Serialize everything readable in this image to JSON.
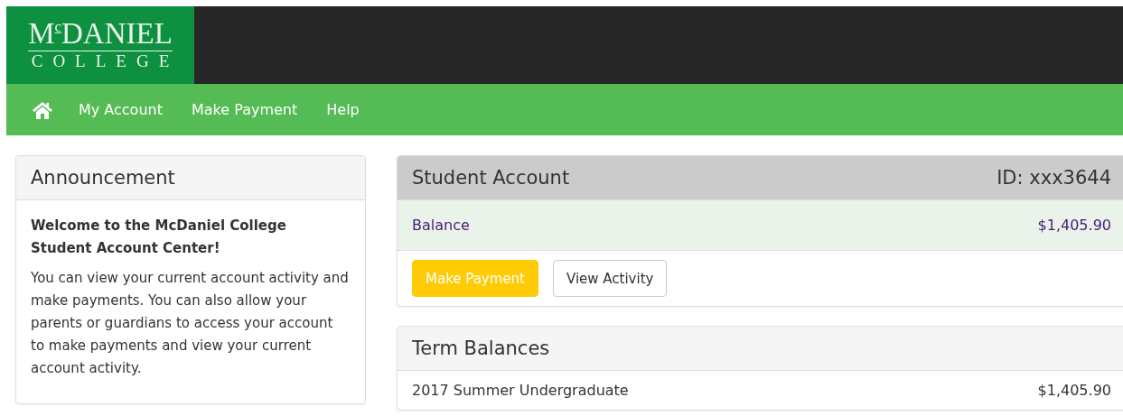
{
  "logo": {
    "name": "M$^{c}$DANIEL",
    "subtitle": "COLLEGE"
  },
  "nav": {
    "items": [
      {
        "kind": "home"
      },
      {
        "kind": "link",
        "label": "My Account"
      },
      {
        "kind": "link",
        "label": "Make Payment"
      },
      {
        "kind": "link",
        "label": "Help"
      }
    ]
  },
  "announcement": {
    "title": "Announcement",
    "heading": "Welcome to the McDaniel College Student Account Center!",
    "body": "You can view your current account activity and make payments. You can also allow your parents or guardians to access your account to make payments and view your current account activity."
  },
  "student_account": {
    "title": "Student Account",
    "id": "ID: xxx3644",
    "balance_label": "Balance",
    "balance": "$1,405.90",
    "buttons": [
      {
        "kind": "primary",
        "label": "Make Payment"
      },
      {
        "kind": "default",
        "label": "View Activity"
      }
    ]
  },
  "term_balances": {
    "title": "Term Balances",
    "rows": [
      {
        "term": "2017 Summer Undergraduate",
        "amount": "$1,405.90"
      }
    ]
  }
}
